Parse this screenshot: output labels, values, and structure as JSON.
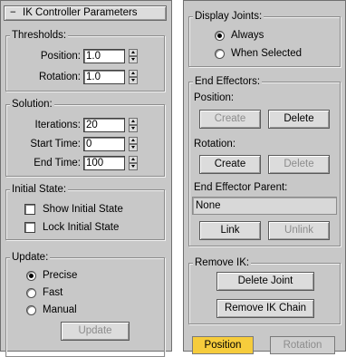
{
  "left_panel": {
    "rollout_toggle": "−",
    "rollout_title": "IK Controller Parameters",
    "thresholds": {
      "title": "Thresholds:",
      "position_label": "Position:",
      "position_value": "1.0",
      "rotation_label": "Rotation:",
      "rotation_value": "1.0"
    },
    "solution": {
      "title": "Solution:",
      "iterations_label": "Iterations:",
      "iterations_value": "20",
      "start_time_label": "Start Time:",
      "start_time_value": "0",
      "end_time_label": "End Time:",
      "end_time_value": "100"
    },
    "initial_state": {
      "title": "Initial State:",
      "show_label": "Show Initial State",
      "lock_label": "Lock Initial State"
    },
    "update": {
      "title": "Update:",
      "precise_label": "Precise",
      "fast_label": "Fast",
      "manual_label": "Manual",
      "selected": "Precise",
      "update_button": "Update"
    }
  },
  "right_panel": {
    "display_joints": {
      "title": "Display Joints:",
      "always_label": "Always",
      "when_selected_label": "When Selected",
      "selected": "Always"
    },
    "end_effectors": {
      "title": "End Effectors:",
      "position_label": "Position:",
      "position_create": "Create",
      "position_delete": "Delete",
      "rotation_label": "Rotation:",
      "rotation_create": "Create",
      "rotation_delete": "Delete",
      "parent_label": "End Effector Parent:",
      "parent_value": "None",
      "link_button": "Link",
      "unlink_button": "Unlink"
    },
    "remove_ik": {
      "title": "Remove IK:",
      "delete_joint": "Delete Joint",
      "remove_chain": "Remove IK Chain"
    },
    "bottom_tabs": {
      "position": "Position",
      "rotation": "Rotation"
    }
  },
  "colors": {
    "panel_bg": "#c8c8c8",
    "active_tab": "#f6cc3c",
    "disabled_text": "#8c8c8c"
  }
}
